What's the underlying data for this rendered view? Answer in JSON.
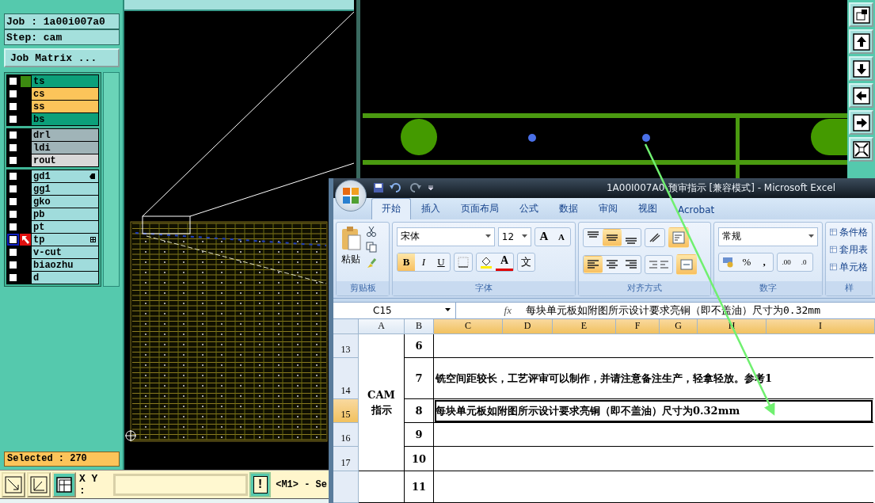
{
  "cam": {
    "job_label": "Job : 1a00i007a0",
    "step_label": "Step: cam",
    "matrix_button": "Job Matrix ...",
    "layer_groups": [
      [
        {
          "name": "ts",
          "color": "#0ca07a",
          "checked": false,
          "selected": false,
          "display": true
        },
        {
          "name": "cs",
          "color": "#fcc45a",
          "checked": false,
          "selected": false
        },
        {
          "name": "ss",
          "color": "#fcc45a",
          "checked": false,
          "selected": false
        },
        {
          "name": "bs",
          "color": "#0ca07a",
          "checked": false,
          "selected": false
        }
      ],
      [
        {
          "name": "drl",
          "color": "#a0b4b8",
          "checked": false,
          "selected": false
        },
        {
          "name": "ldi",
          "color": "#a0b4b8",
          "checked": false,
          "selected": false
        },
        {
          "name": "rout",
          "color": "#d8d8d8",
          "checked": false,
          "selected": false
        }
      ],
      [
        {
          "name": "gd1",
          "color": "#a0dcdc",
          "checked": false,
          "selected": false,
          "hand_mark": true
        },
        {
          "name": "gg1",
          "color": "#a0dcdc",
          "checked": false,
          "selected": false
        },
        {
          "name": "gko",
          "color": "#a0dcdc",
          "checked": false,
          "selected": false
        },
        {
          "name": "pb",
          "color": "#a0dcdc",
          "checked": false,
          "selected": false
        },
        {
          "name": "pt",
          "color": "#a0dcdc",
          "checked": false,
          "selected": false
        },
        {
          "name": "tp",
          "color": "#a0dcdc",
          "checked": false,
          "selected": true,
          "work": true,
          "grid_mark": true
        },
        {
          "name": "v-cut",
          "color": "#a0dcdc",
          "checked": false,
          "selected": false
        },
        {
          "name": "biaozhu",
          "color": "#a0dcdc",
          "checked": false,
          "selected": false
        },
        {
          "name": "d",
          "color": "#a0dcdc",
          "checked": false,
          "selected": false
        }
      ]
    ],
    "selected_count": "Selected : 270",
    "xy_label": "X Y :",
    "alert_button": "!",
    "status": "<M1> - Se",
    "view_tools": [
      {
        "kind": "zoom-box"
      },
      {
        "kind": "up"
      },
      {
        "kind": "down"
      },
      {
        "kind": "left"
      },
      {
        "kind": "right"
      },
      {
        "kind": "fit"
      }
    ]
  },
  "excel": {
    "title": "1A00I007A0-预审指示  [兼容模式]  - Microsoft Excel",
    "tabs": [
      {
        "label": "开始",
        "selected": true
      },
      {
        "label": "插入",
        "selected": false
      },
      {
        "label": "页面布局",
        "selected": false
      },
      {
        "label": "公式",
        "selected": false
      },
      {
        "label": "数据",
        "selected": false
      },
      {
        "label": "审阅",
        "selected": false
      },
      {
        "label": "视图",
        "selected": false
      },
      {
        "label": "Acrobat",
        "selected": false
      }
    ],
    "clipboard": {
      "paste": "粘贴",
      "label": "剪贴板"
    },
    "font": {
      "name": "宋体",
      "size": "12",
      "grow": "A",
      "shrink": "A",
      "label": "字体",
      "styles": [
        {
          "kind": "bold",
          "label": "B",
          "selected": true
        },
        {
          "kind": "italic",
          "label": "I",
          "selected": false
        },
        {
          "kind": "underline",
          "label": "U",
          "selected": false
        }
      ],
      "font_color": "A",
      "phonetic": "文"
    },
    "alignment": {
      "label": "对齐方式",
      "top": [
        {
          "kind": "top",
          "selected": false
        },
        {
          "kind": "middle",
          "selected": true
        },
        {
          "kind": "bottom",
          "selected": false
        }
      ],
      "bottom": [
        {
          "kind": "left",
          "selected": true
        },
        {
          "kind": "center",
          "selected": false
        },
        {
          "kind": "right",
          "selected": false
        }
      ],
      "wrap_selected": true,
      "merge_selected": true
    },
    "number": {
      "format": "常规",
      "label": "数字",
      "buttons": [
        "%",
        ",",
        ".00",
        ".0"
      ]
    },
    "styles": {
      "items": [
        "条件格",
        "套用表",
        "单元格"
      ],
      "label": "样"
    },
    "name_box": "C15",
    "fx": "fx",
    "formula": "每块单元板如附图所示设计要求亮铜（即不盖油）尺寸为0.32mm",
    "columns": [
      {
        "label": "A",
        "selected": false
      },
      {
        "label": "B",
        "selected": false
      },
      {
        "label": "C",
        "selected": true
      },
      {
        "label": "D",
        "selected": true
      },
      {
        "label": "E",
        "selected": true
      },
      {
        "label": "F",
        "selected": true
      },
      {
        "label": "G",
        "selected": true
      },
      {
        "label": "H",
        "selected": true
      },
      {
        "label": "I",
        "selected": true
      }
    ],
    "section": "CAM指示",
    "rows": [
      {
        "row": "13",
        "item": "6",
        "selected": false
      },
      {
        "row": "14",
        "item": "7",
        "selected": false,
        "text": "铣空间距较长，工艺评审可以制作，并请注意备注生产，轻拿轻放。参考1"
      },
      {
        "row": "15",
        "item": "8",
        "selected": true,
        "text": "每块单元板如附图所示设计要求亮铜（即不盖油）尺寸为0.32mm"
      },
      {
        "row": "16",
        "item": "9",
        "selected": false
      },
      {
        "row": "17",
        "item": "10",
        "selected": false
      },
      {
        "item": "11",
        "selected": false
      }
    ]
  }
}
